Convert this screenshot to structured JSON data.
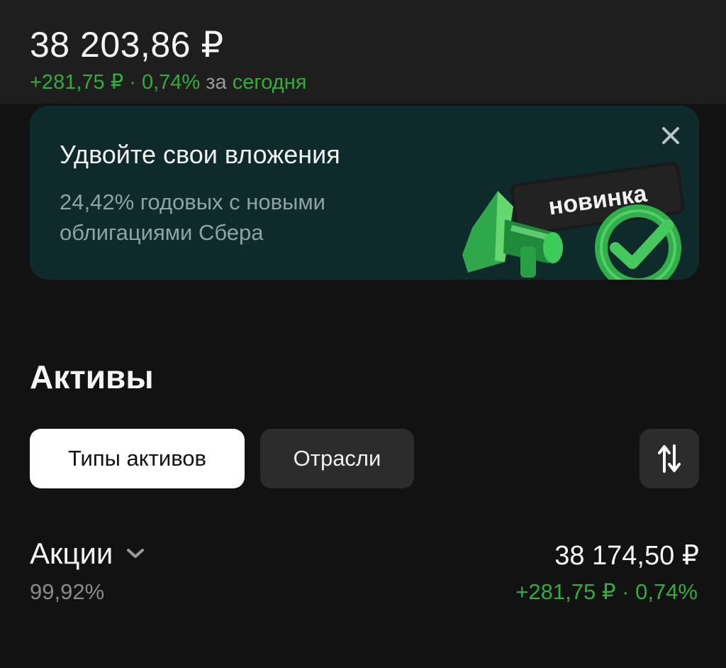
{
  "header": {
    "balance": "38 203,86 ₽",
    "change_amount": "+281,75 ₽",
    "change_sep": " · ",
    "change_percent": "0,74%",
    "period_prefix": " за ",
    "period": "сегодня"
  },
  "banner": {
    "title": "Удвойте свои вложения",
    "subtitle": "24,42% годовых с новыми облигациями Сбера",
    "badge": "новинка",
    "close_icon": "close-icon"
  },
  "assets": {
    "title": "Активы",
    "filters": [
      "Типы активов",
      "Отрасли"
    ],
    "active_filter": "Типы активов",
    "sort_icon": "sort-arrows-icon",
    "items": [
      {
        "name": "Акции",
        "share": "99,92%",
        "value": "38 174,50 ₽",
        "change": "+281,75 ₽ · 0,74%"
      }
    ]
  },
  "colors": {
    "background": "#121212",
    "header_bg": "#1e1e1e",
    "banner_bg": "#0e2a2b",
    "positive": "#2fae3a",
    "chip_active": "#ffffff",
    "chip_inactive": "#2c2c2c"
  }
}
